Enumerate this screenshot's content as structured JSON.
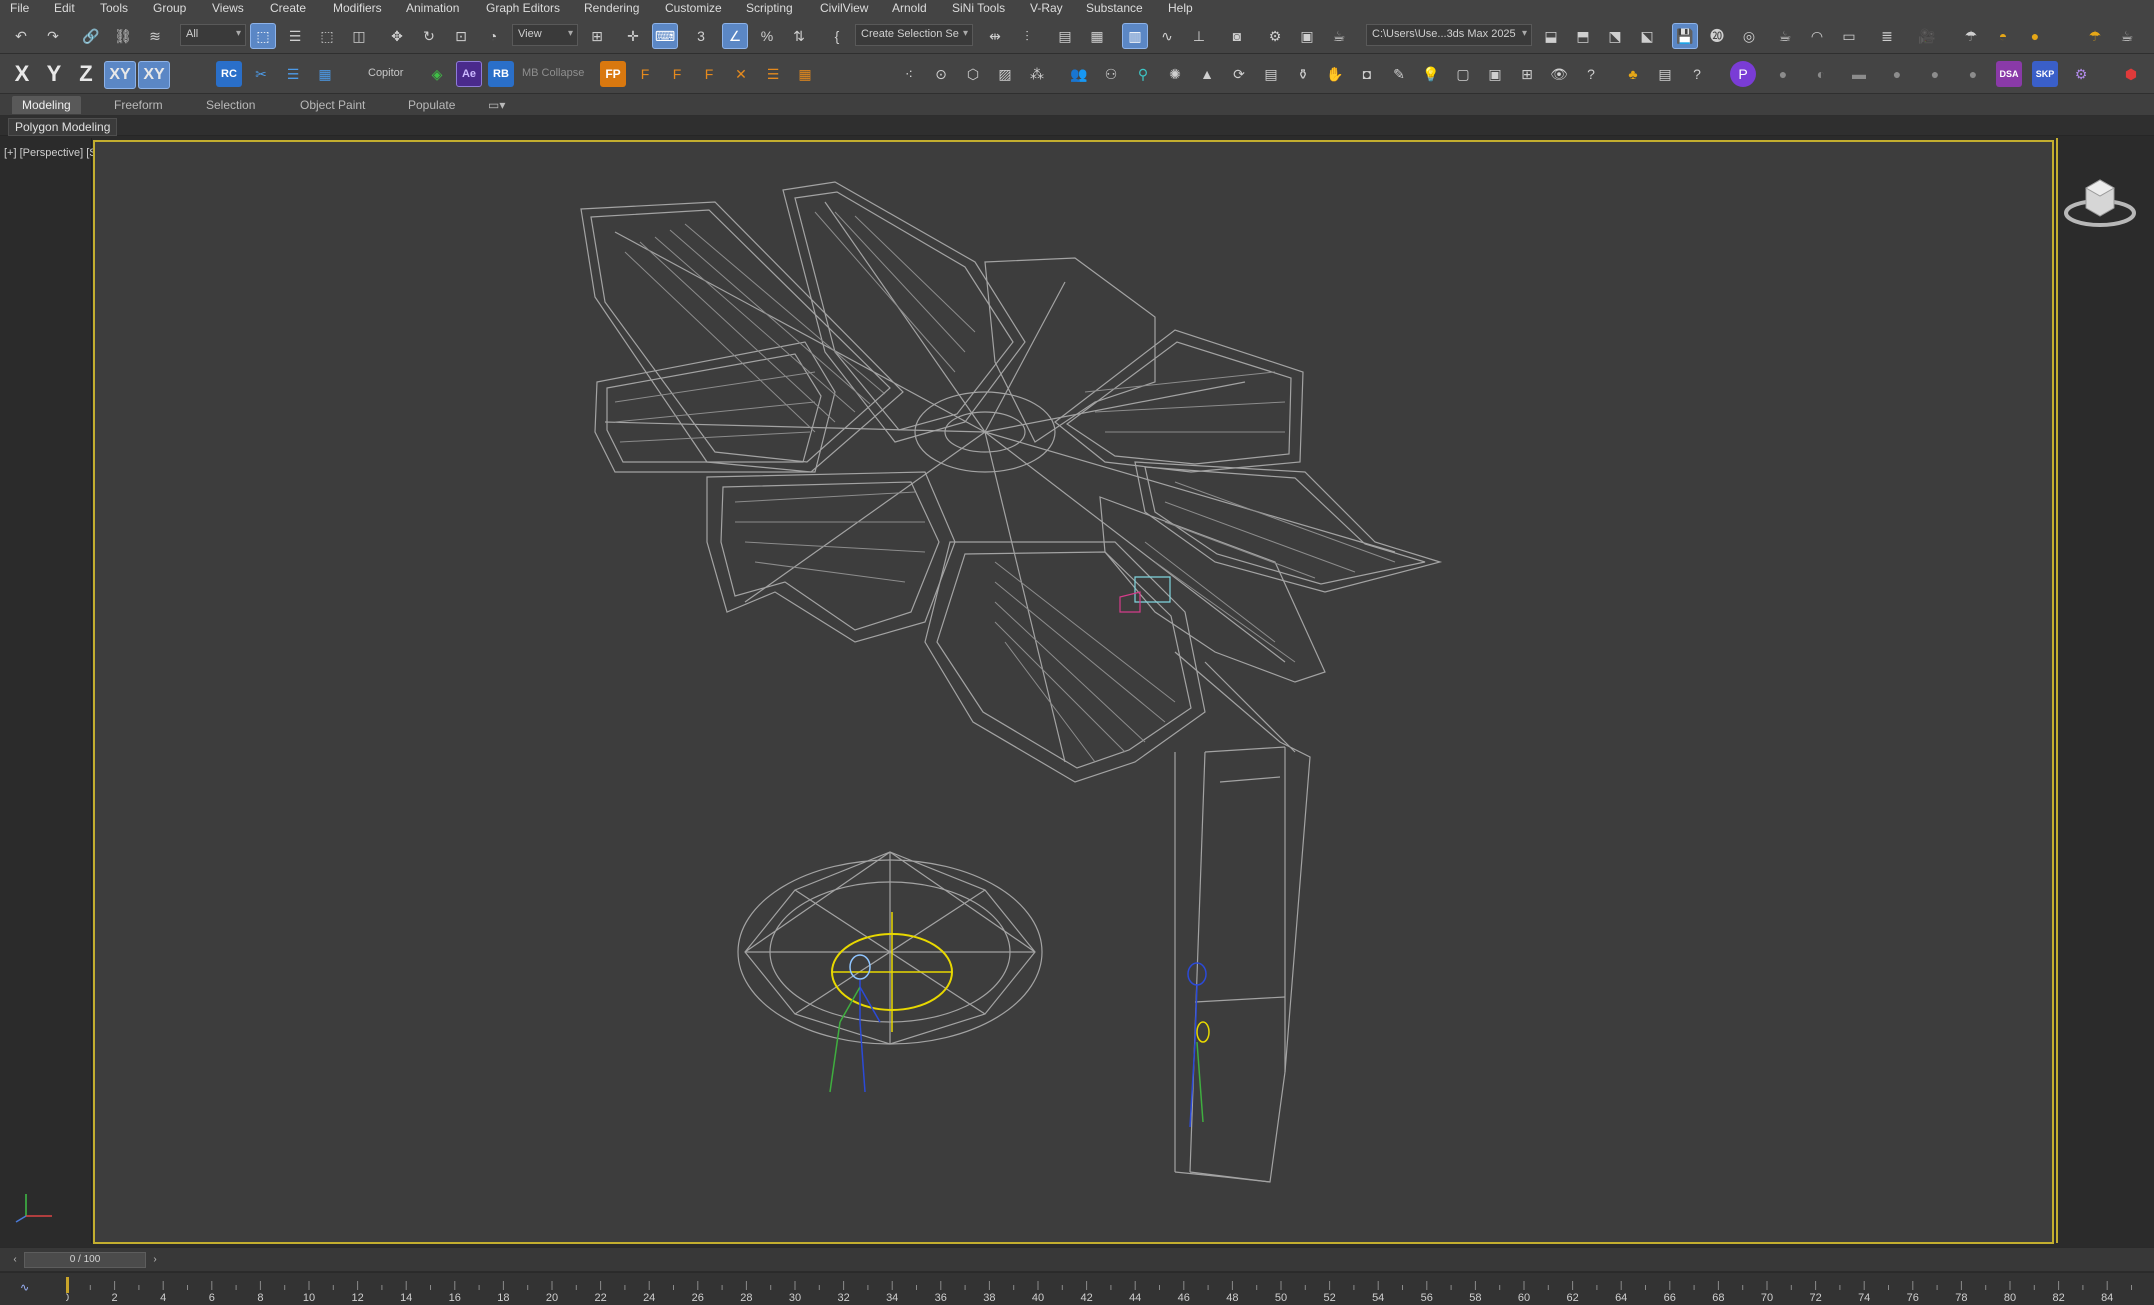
{
  "menu": [
    "File",
    "Edit",
    "Tools",
    "Group",
    "Views",
    "Create",
    "Modifiers",
    "Animation",
    "Graph Editors",
    "Rendering",
    "Customize",
    "Scripting",
    "CivilView",
    "Arnold",
    "SiNi Tools",
    "V-Ray",
    "Substance",
    "Help"
  ],
  "toolbar1": {
    "selection_filter": "All",
    "ref_coord": "View",
    "named_selection": "Create Selection Se",
    "project_path": "C:\\Users\\Use...3ds Max 2025"
  },
  "toolbar2": {
    "axes": [
      "X",
      "Y",
      "Z",
      "XY",
      "XY"
    ],
    "rc_label": "RC",
    "copitor_label": "Copitor",
    "ae_label": "Ae",
    "rb_label": "RB",
    "mb_collapse_label": "MB Collapse",
    "fp_label": "FP",
    "dsa_label": "DSA",
    "skp_label": "SKP"
  },
  "ribbon": {
    "tabs": [
      "Modeling",
      "Freeform",
      "Selection",
      "Object Paint",
      "Populate"
    ],
    "active_tab": "Modeling",
    "panel": "Polygon Modeling"
  },
  "viewport": {
    "label": "[+] [Perspective] [Standard] [Wireframe]",
    "shading": "Wireframe"
  },
  "timeline": {
    "slider": "0 / 100",
    "current_frame": 0,
    "ticks": [
      0,
      2,
      4,
      6,
      8,
      10,
      12,
      14,
      16,
      18,
      20,
      22,
      24,
      26,
      28,
      30,
      32,
      34,
      36,
      38,
      40,
      42,
      44,
      46,
      48,
      50,
      52,
      54,
      56,
      58,
      60,
      62,
      64,
      66,
      68,
      70,
      72,
      74,
      76,
      78,
      80,
      82,
      84
    ]
  },
  "colors": {
    "ui_bg": "#444444",
    "viewport_bg": "#3d3d3d",
    "active_viewport_border": "#c3ae2f",
    "wire": "#b5b5b5",
    "accent": "#5b87c5"
  }
}
